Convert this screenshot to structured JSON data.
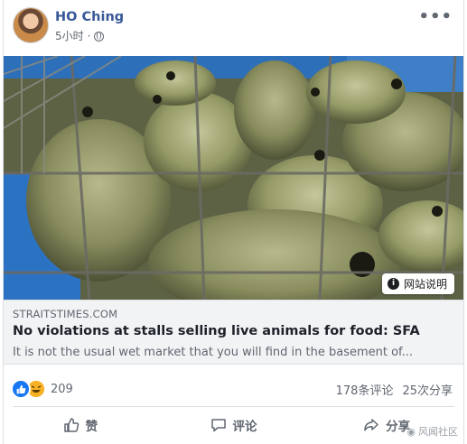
{
  "post": {
    "author": "HO Ching",
    "time": "5小时",
    "more_icon": "ellipsis-icon"
  },
  "image": {
    "info_label": "网站说明"
  },
  "link": {
    "domain": "STRAITSTIMES.COM",
    "headline": "No violations at stalls selling live animals for food: SFA",
    "description": "It is not the usual wet market that you will find in the basement of..."
  },
  "stats": {
    "reaction_count": "209",
    "comments": "178条评论",
    "shares": "25次分享"
  },
  "actions": {
    "like": "赞",
    "comment": "评论",
    "share": "分享"
  },
  "watermark": "风闻社区",
  "colors": {
    "brand_link": "#385898",
    "like_blue": "#1877f2",
    "haha_yellow": "#f7b125",
    "secondary_text": "#606770"
  }
}
